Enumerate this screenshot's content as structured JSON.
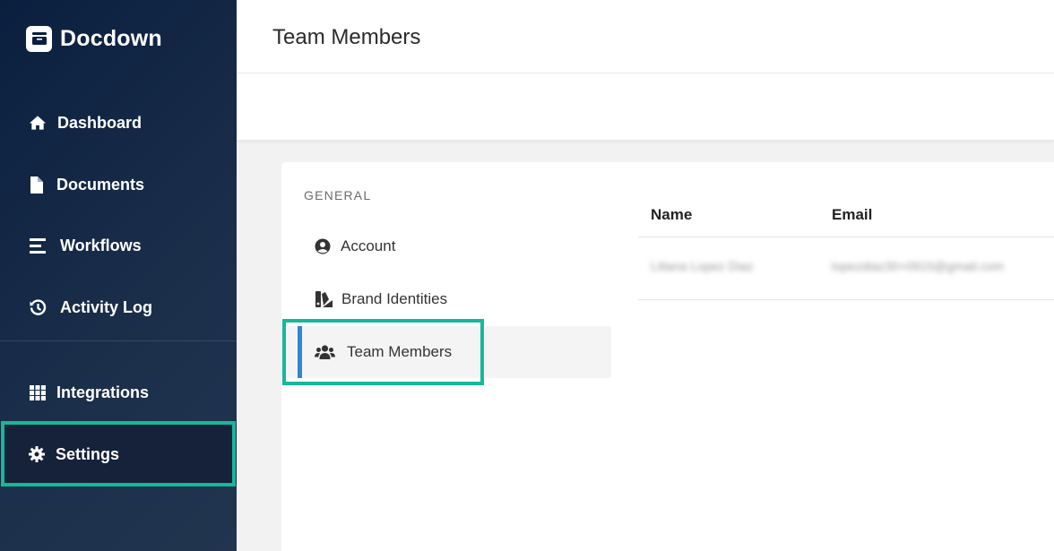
{
  "app": {
    "name": "Docdown"
  },
  "sidebar": {
    "items": [
      {
        "label": "Dashboard"
      },
      {
        "label": "Documents"
      },
      {
        "label": "Workflows"
      },
      {
        "label": "Activity Log"
      },
      {
        "label": "Integrations"
      },
      {
        "label": "Settings"
      }
    ]
  },
  "header": {
    "title": "Team Members"
  },
  "settings_nav": {
    "section_label": "GENERAL",
    "items": [
      {
        "label": "Account"
      },
      {
        "label": "Brand Identities"
      },
      {
        "label": "Team Members"
      }
    ]
  },
  "members_table": {
    "columns": [
      "Name",
      "Email"
    ],
    "rows": [
      {
        "name": "Liliana Lopez Diaz",
        "email": "lopezdiaz30+0915@gmail.com"
      }
    ]
  },
  "colors": {
    "highlight": "#16b89a",
    "active_indicator": "#2f86d6",
    "sidebar_bg": "#0a1f3f"
  }
}
